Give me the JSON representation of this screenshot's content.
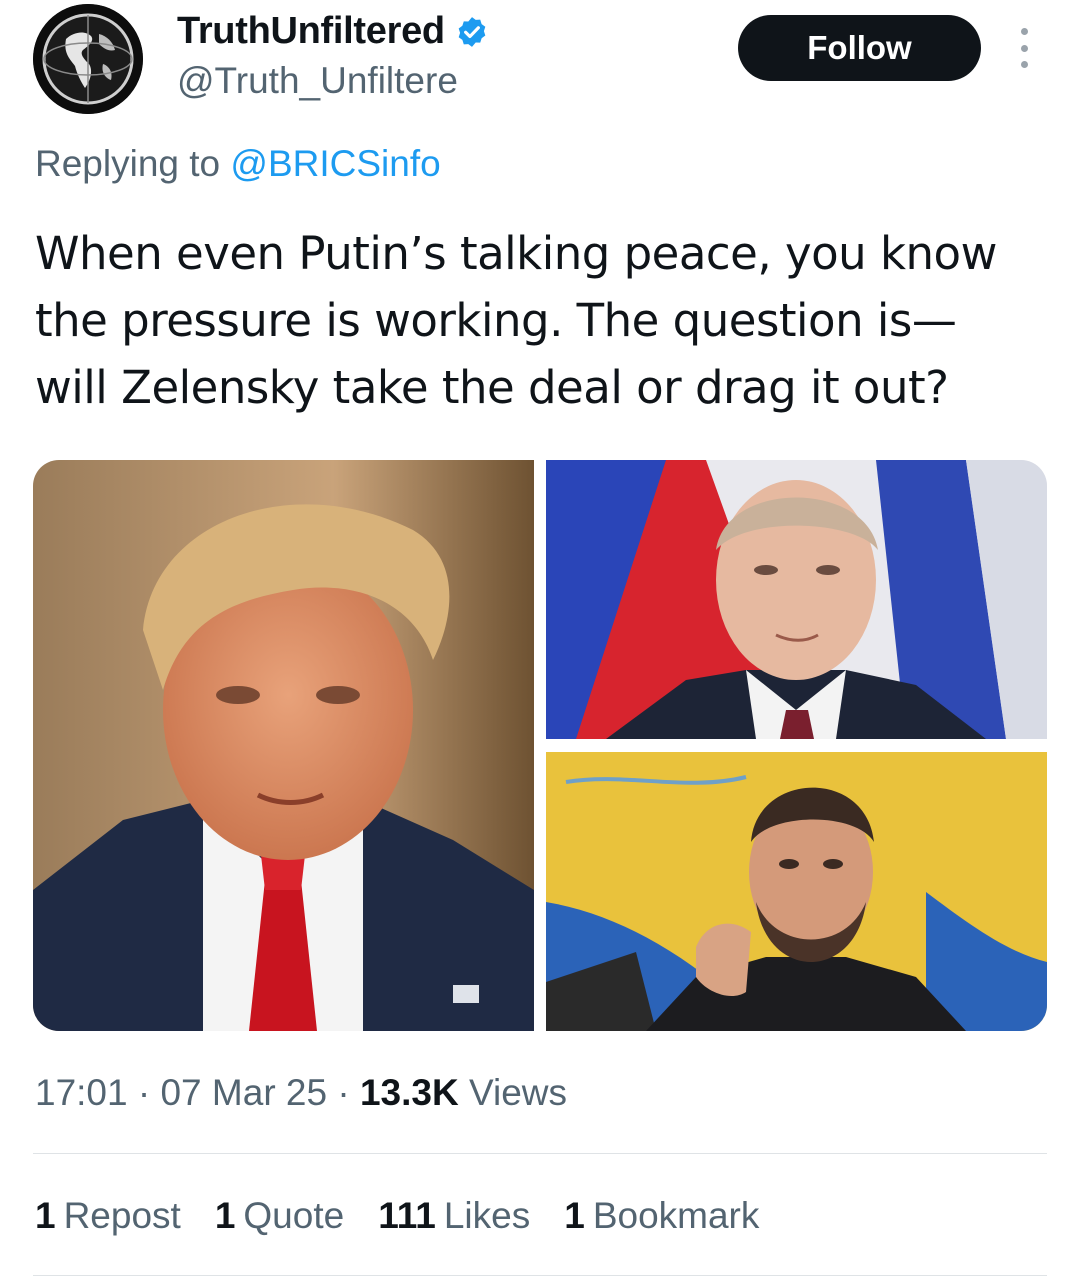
{
  "author": {
    "display_name": "TruthUnfiltered",
    "handle": "@Truth_Unfiltere",
    "verified_icon": "verified-badge-icon",
    "avatar_icon": "globe-avatar"
  },
  "follow_label": "Follow",
  "reply": {
    "prefix": "Replying to",
    "mention": "@BRICSinfo"
  },
  "tweet": {
    "text_line1": "When even Putin’s talking peace, you know",
    "text_line2": "the pressure is working. The question is—",
    "text_line3": "will Zelensky take the deal or drag it out?"
  },
  "meta": {
    "time": "17:01",
    "date": "07 Mar 25",
    "views_count": "13.3K",
    "views_label": "Views"
  },
  "stats": {
    "reposts_count": "1",
    "reposts_label": "Repost",
    "quotes_count": "1",
    "quotes_label": "Quote",
    "likes_count": "111",
    "likes_label": "Likes",
    "bookmarks_count": "1",
    "bookmarks_label": "Bookmark"
  },
  "colors": {
    "accent": "#1d9bf0",
    "text": "#0f1419",
    "secondary": "#536471",
    "button_bg": "#0f1419"
  }
}
